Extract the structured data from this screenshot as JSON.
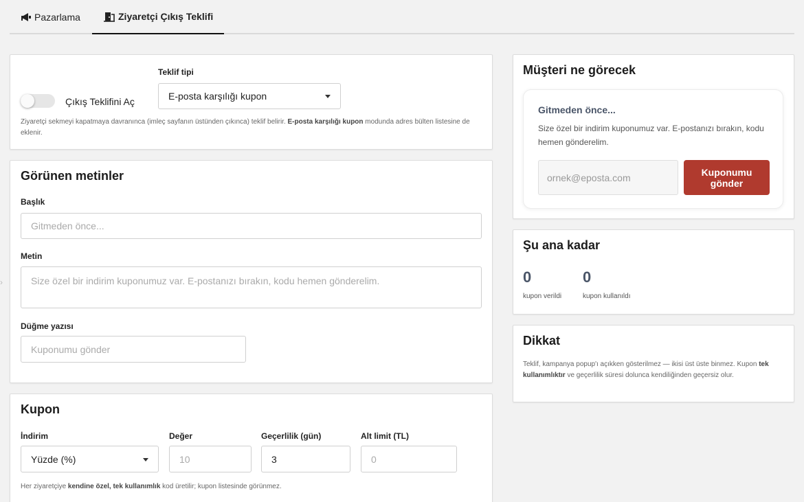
{
  "tabs": [
    {
      "label": "Pazarlama",
      "icon": "megaphone-icon",
      "active": false
    },
    {
      "label": "Ziyaretçi Çıkış Teklifi",
      "icon": "door-exit-icon",
      "active": true
    }
  ],
  "offer": {
    "toggle_label": "Çıkış Teklifini Aç",
    "toggle_on": false,
    "type_label": "Teklif tipi",
    "type_value": "E-posta karşılığı kupon",
    "help_pre": "Ziyaretçi sekmeyi kapatmaya davranınca (imleç sayfanın üstünden çıkınca) teklif belirir. ",
    "help_bold": "E-posta karşılığı kupon",
    "help_post": " modunda adres bülten listesine de eklenir."
  },
  "texts": {
    "title": "Görünen metinler",
    "heading_label": "Başlık",
    "heading_placeholder": "Gitmeden önce...",
    "body_label": "Metin",
    "body_placeholder": "Size özel bir indirim kuponumuz var. E-postanızı bırakın, kodu hemen gönderelim.",
    "button_label": "Düğme yazısı",
    "button_placeholder": "Kuponumu gönder"
  },
  "coupon": {
    "title": "Kupon",
    "discount_label": "İndirim",
    "discount_value": "Yüzde (%)",
    "amount_label": "Değer",
    "amount_placeholder": "10",
    "validity_label": "Geçerlilik (gün)",
    "validity_value": "3",
    "min_label": "Alt limit (TL)",
    "min_placeholder": "0",
    "help_pre": "Her ziyaretçiye ",
    "help_bold": "kendine özel, tek kullanımlık",
    "help_post": " kod üretilir; kupon listesinde görünmez."
  },
  "preview": {
    "title": "Müşteri ne görecek",
    "popup_title": "Gitmeden önce...",
    "popup_body": "Size özel bir indirim kuponumuz var. E-postanızı bırakın, kodu hemen gönderelim.",
    "email_placeholder": "ornek@eposta.com",
    "button": "Kuponumu gönder",
    "accent_color": "#b03a2e"
  },
  "stats": {
    "title": "Şu ana kadar",
    "issued": "0",
    "issued_label": "kupon verildi",
    "used": "0",
    "used_label": "kupon kullanıldı"
  },
  "notice": {
    "title": "Dikkat",
    "text_pre": "Teklif, kampanya popup'ı açıkken gösterilmez — ikisi üst üste binmez. Kupon ",
    "text_bold": "tek kullanımlıktır",
    "text_post": " ve geçerlilik süresi dolunca kendiliğinden geçersiz olur."
  }
}
